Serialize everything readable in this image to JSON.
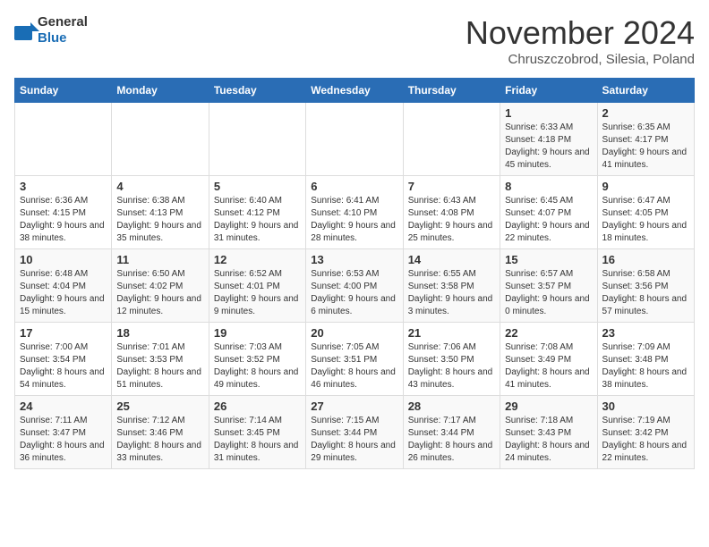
{
  "logo": {
    "text1": "General",
    "text2": "Blue"
  },
  "title": "November 2024",
  "location": "Chruszczobrod, Silesia, Poland",
  "header_days": [
    "Sunday",
    "Monday",
    "Tuesday",
    "Wednesday",
    "Thursday",
    "Friday",
    "Saturday"
  ],
  "weeks": [
    [
      {
        "day": "",
        "info": ""
      },
      {
        "day": "",
        "info": ""
      },
      {
        "day": "",
        "info": ""
      },
      {
        "day": "",
        "info": ""
      },
      {
        "day": "",
        "info": ""
      },
      {
        "day": "1",
        "info": "Sunrise: 6:33 AM\nSunset: 4:18 PM\nDaylight: 9 hours and 45 minutes."
      },
      {
        "day": "2",
        "info": "Sunrise: 6:35 AM\nSunset: 4:17 PM\nDaylight: 9 hours and 41 minutes."
      }
    ],
    [
      {
        "day": "3",
        "info": "Sunrise: 6:36 AM\nSunset: 4:15 PM\nDaylight: 9 hours and 38 minutes."
      },
      {
        "day": "4",
        "info": "Sunrise: 6:38 AM\nSunset: 4:13 PM\nDaylight: 9 hours and 35 minutes."
      },
      {
        "day": "5",
        "info": "Sunrise: 6:40 AM\nSunset: 4:12 PM\nDaylight: 9 hours and 31 minutes."
      },
      {
        "day": "6",
        "info": "Sunrise: 6:41 AM\nSunset: 4:10 PM\nDaylight: 9 hours and 28 minutes."
      },
      {
        "day": "7",
        "info": "Sunrise: 6:43 AM\nSunset: 4:08 PM\nDaylight: 9 hours and 25 minutes."
      },
      {
        "day": "8",
        "info": "Sunrise: 6:45 AM\nSunset: 4:07 PM\nDaylight: 9 hours and 22 minutes."
      },
      {
        "day": "9",
        "info": "Sunrise: 6:47 AM\nSunset: 4:05 PM\nDaylight: 9 hours and 18 minutes."
      }
    ],
    [
      {
        "day": "10",
        "info": "Sunrise: 6:48 AM\nSunset: 4:04 PM\nDaylight: 9 hours and 15 minutes."
      },
      {
        "day": "11",
        "info": "Sunrise: 6:50 AM\nSunset: 4:02 PM\nDaylight: 9 hours and 12 minutes."
      },
      {
        "day": "12",
        "info": "Sunrise: 6:52 AM\nSunset: 4:01 PM\nDaylight: 9 hours and 9 minutes."
      },
      {
        "day": "13",
        "info": "Sunrise: 6:53 AM\nSunset: 4:00 PM\nDaylight: 9 hours and 6 minutes."
      },
      {
        "day": "14",
        "info": "Sunrise: 6:55 AM\nSunset: 3:58 PM\nDaylight: 9 hours and 3 minutes."
      },
      {
        "day": "15",
        "info": "Sunrise: 6:57 AM\nSunset: 3:57 PM\nDaylight: 9 hours and 0 minutes."
      },
      {
        "day": "16",
        "info": "Sunrise: 6:58 AM\nSunset: 3:56 PM\nDaylight: 8 hours and 57 minutes."
      }
    ],
    [
      {
        "day": "17",
        "info": "Sunrise: 7:00 AM\nSunset: 3:54 PM\nDaylight: 8 hours and 54 minutes."
      },
      {
        "day": "18",
        "info": "Sunrise: 7:01 AM\nSunset: 3:53 PM\nDaylight: 8 hours and 51 minutes."
      },
      {
        "day": "19",
        "info": "Sunrise: 7:03 AM\nSunset: 3:52 PM\nDaylight: 8 hours and 49 minutes."
      },
      {
        "day": "20",
        "info": "Sunrise: 7:05 AM\nSunset: 3:51 PM\nDaylight: 8 hours and 46 minutes."
      },
      {
        "day": "21",
        "info": "Sunrise: 7:06 AM\nSunset: 3:50 PM\nDaylight: 8 hours and 43 minutes."
      },
      {
        "day": "22",
        "info": "Sunrise: 7:08 AM\nSunset: 3:49 PM\nDaylight: 8 hours and 41 minutes."
      },
      {
        "day": "23",
        "info": "Sunrise: 7:09 AM\nSunset: 3:48 PM\nDaylight: 8 hours and 38 minutes."
      }
    ],
    [
      {
        "day": "24",
        "info": "Sunrise: 7:11 AM\nSunset: 3:47 PM\nDaylight: 8 hours and 36 minutes."
      },
      {
        "day": "25",
        "info": "Sunrise: 7:12 AM\nSunset: 3:46 PM\nDaylight: 8 hours and 33 minutes."
      },
      {
        "day": "26",
        "info": "Sunrise: 7:14 AM\nSunset: 3:45 PM\nDaylight: 8 hours and 31 minutes."
      },
      {
        "day": "27",
        "info": "Sunrise: 7:15 AM\nSunset: 3:44 PM\nDaylight: 8 hours and 29 minutes."
      },
      {
        "day": "28",
        "info": "Sunrise: 7:17 AM\nSunset: 3:44 PM\nDaylight: 8 hours and 26 minutes."
      },
      {
        "day": "29",
        "info": "Sunrise: 7:18 AM\nSunset: 3:43 PM\nDaylight: 8 hours and 24 minutes."
      },
      {
        "day": "30",
        "info": "Sunrise: 7:19 AM\nSunset: 3:42 PM\nDaylight: 8 hours and 22 minutes."
      }
    ]
  ]
}
